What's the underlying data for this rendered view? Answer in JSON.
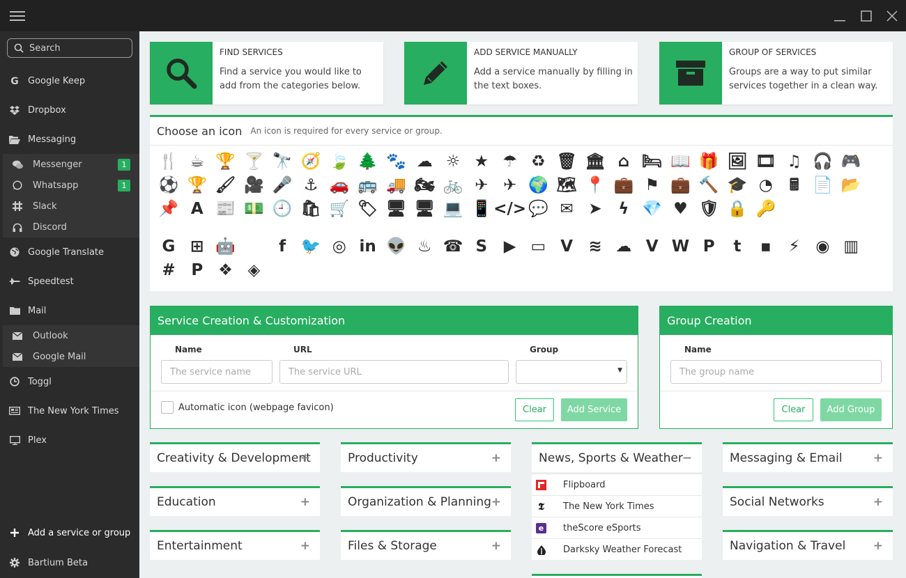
{
  "window": {
    "menu_icon": "hamburger-icon",
    "minimize_icon": "minimize-icon",
    "maximize_icon": "maximize-icon",
    "close_icon": "close-icon"
  },
  "sidebar": {
    "search_placeholder": "Search",
    "items": [
      {
        "label": "Google Keep",
        "icon": "google-icon"
      },
      {
        "label": "Dropbox",
        "icon": "dropbox-icon"
      },
      {
        "label": "Messaging",
        "icon": "folder-open-icon"
      },
      {
        "label": "Google Translate",
        "icon": "globe-icon"
      },
      {
        "label": "Speedtest",
        "icon": "plane-icon"
      },
      {
        "label": "Mail",
        "icon": "folder-icon"
      },
      {
        "label": "Toggl",
        "icon": "clock-icon"
      },
      {
        "label": "The New York Times",
        "icon": "newspaper-icon"
      },
      {
        "label": "Plex",
        "icon": "monitor-icon"
      }
    ],
    "messaging_children": [
      {
        "label": "Messenger",
        "badge": "1"
      },
      {
        "label": "Whatsapp",
        "badge": "1"
      },
      {
        "label": "Slack"
      },
      {
        "label": "Discord"
      }
    ],
    "mail_children": [
      {
        "label": "Outlook"
      },
      {
        "label": "Google Mail"
      }
    ],
    "add_label": "Add a service or group",
    "beta_label": "Bartium Beta"
  },
  "cards": [
    {
      "title": "FIND SERVICES",
      "desc": "Find a service you would like to add from the categories below.",
      "icon": "search-icon"
    },
    {
      "title": "ADD SERVICE MANUALLY",
      "desc": "Add a service manually by filling in the text boxes.",
      "icon": "pencil-icon"
    },
    {
      "title": "GROUP OF SERVICES",
      "desc": "Groups are a way to put similar services together in a clean way.",
      "icon": "archive-icon"
    }
  ],
  "icon_panel": {
    "title": "Choose an icon",
    "subtitle": "An icon is required for every service or group.",
    "glyph_rows": [
      [
        "🍴",
        "☕",
        "🏆",
        "🍸",
        "🔭",
        "🧭",
        "🍃",
        "🌲",
        "🐾",
        "☁",
        "☼",
        "★",
        "☂",
        "♻",
        "🗑",
        "🏛",
        "⌂",
        "🛏",
        "📖",
        "🎁",
        "🖼",
        "🎞",
        "♫",
        "🎧",
        "🎮"
      ],
      [
        "⚽",
        "🏆",
        "🖌",
        "🎥",
        "🎤",
        "⚓",
        "🚗",
        "🚌",
        "🚚",
        "🏍",
        "🚲",
        "✈",
        "✈",
        "🌍",
        "🗺",
        "📍",
        "💼",
        "⚑",
        "💼",
        "🔨",
        "🎓",
        "◔",
        "🖩",
        "📄",
        "📂"
      ],
      [
        "📌",
        "A",
        "📰",
        "💵",
        "🕘",
        "🛍",
        "🛒",
        "🏷",
        "🖥",
        "🖥",
        "💻",
        "📱",
        "</>",
        "💬",
        "✉",
        "➤",
        "ϟ",
        "💎",
        "♥",
        "🛡",
        "🔒",
        "🔑"
      ],
      [
        "G",
        "⊞",
        "🤖",
        "",
        "f",
        "🐦",
        "◎",
        "in",
        "👽",
        "♨",
        "☎",
        "S",
        "▶",
        "▭",
        "V",
        "≋",
        "☁",
        "V",
        "W",
        "P",
        "t",
        "▪",
        "⚡",
        "◉",
        "▥"
      ],
      [
        "#",
        "P",
        "❖",
        "◈"
      ]
    ]
  },
  "service_form": {
    "title": "Service Creation & Customization",
    "name_label": "Name",
    "url_label": "URL",
    "group_label": "Group",
    "name_placeholder": "The service name",
    "url_placeholder": "The service URL",
    "checkbox_label": "Automatic icon (webpage favicon)",
    "clear_label": "Clear",
    "submit_label": "Add Service"
  },
  "group_form": {
    "title": "Group Creation",
    "name_label": "Name",
    "name_placeholder": "The group name",
    "clear_label": "Clear",
    "submit_label": "Add Group"
  },
  "categories": [
    {
      "label": "Creativity & Development",
      "sign": "+"
    },
    {
      "label": "Education",
      "sign": "+"
    },
    {
      "label": "Entertainment",
      "sign": "+"
    },
    {
      "label": "Productivity",
      "sign": "+"
    },
    {
      "label": "Organization & Planning",
      "sign": "+"
    },
    {
      "label": "Files & Storage",
      "sign": "+"
    },
    {
      "label": "News, Sports & Weather",
      "sign": "−"
    },
    {
      "label": "Messaging & Email",
      "sign": "+"
    },
    {
      "label": "Social Networks",
      "sign": "+"
    },
    {
      "label": "Navigation & Travel",
      "sign": "+"
    }
  ],
  "news_services": [
    {
      "label": "Flipboard",
      "icon_char": "f",
      "color": "#e12828"
    },
    {
      "label": "The New York Times",
      "icon_char": "𝕿",
      "color": "#ffffff"
    },
    {
      "label": "theScore eSports",
      "icon_char": "e",
      "color": "#5b2d8e"
    },
    {
      "label": "Darksky Weather Forecast",
      "icon_char": "◐",
      "color": "#ffffff"
    }
  ]
}
